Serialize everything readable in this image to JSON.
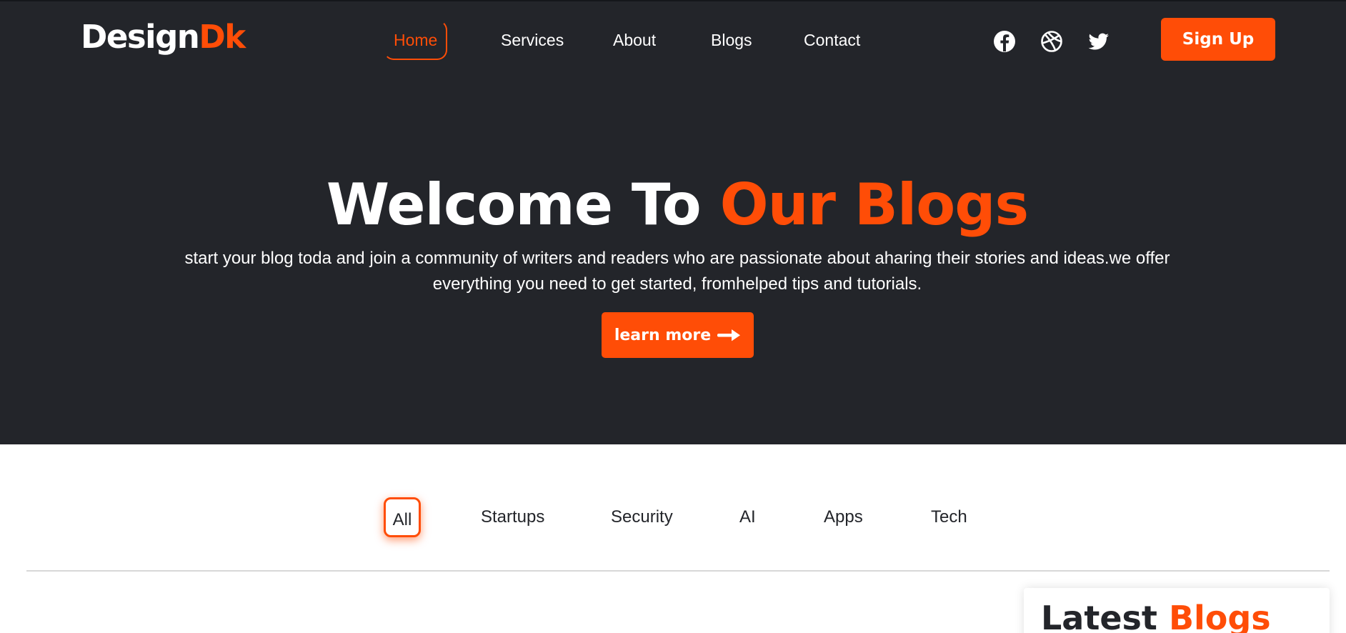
{
  "brand": {
    "logo_main": "Design",
    "logo_accent": "Dk",
    "accent_color": "#ff4d07",
    "dark_color": "#23252a"
  },
  "nav": {
    "items": [
      {
        "label": "Home",
        "active": true
      },
      {
        "label": "Services",
        "active": false
      },
      {
        "label": "About",
        "active": false
      },
      {
        "label": "Blogs",
        "active": false
      },
      {
        "label": "Contact",
        "active": false
      }
    ]
  },
  "social": [
    {
      "icon": "facebook-icon"
    },
    {
      "icon": "dribbble-icon"
    },
    {
      "icon": "twitter-icon"
    }
  ],
  "header": {
    "signup_label": "Sign Up"
  },
  "hero": {
    "title_main": "Welcome To ",
    "title_accent": "Our Blogs",
    "description": "start your blog toda and join a community of writers and readers who are passionate about aharing their stories and ideas.we offer everything you need to get started, fromhelped tips and tutorials.",
    "cta_label": "learn more",
    "cta_icon": "arrow-right-icon"
  },
  "filters": {
    "items": [
      {
        "label": "All",
        "active": true
      },
      {
        "label": "Startups",
        "active": false
      },
      {
        "label": "Security",
        "active": false
      },
      {
        "label": "AI",
        "active": false
      },
      {
        "label": "Apps",
        "active": false
      },
      {
        "label": "Tech",
        "active": false
      }
    ]
  },
  "sidebar": {
    "latest_main": "Latest ",
    "latest_accent": "Blogs"
  }
}
